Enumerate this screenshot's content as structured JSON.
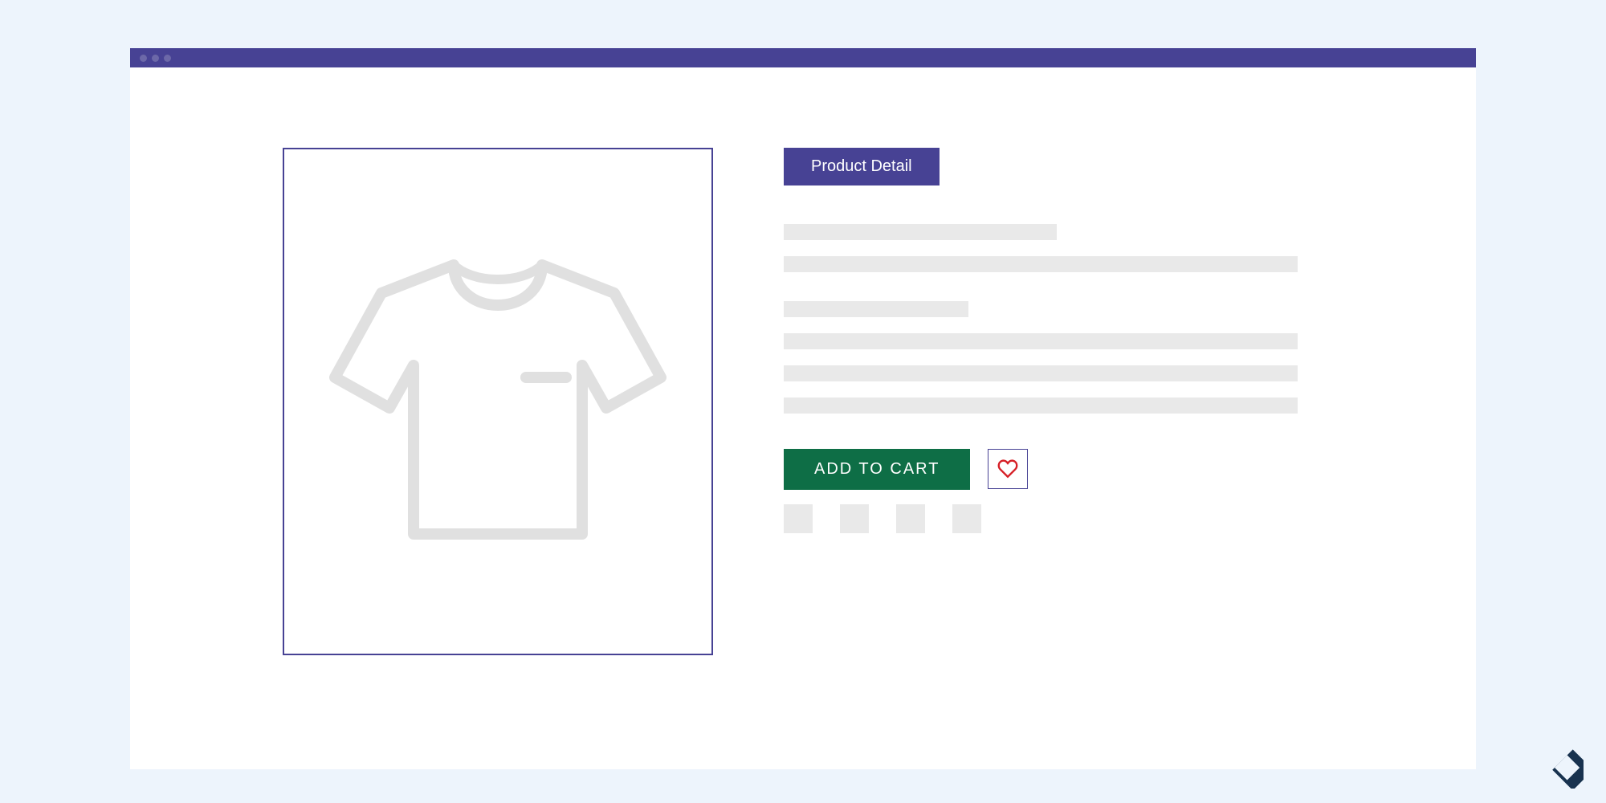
{
  "header": {
    "badge_label": "Product Detail"
  },
  "actions": {
    "add_to_cart_label": "ADD TO CART"
  },
  "colors": {
    "page_bg": "#edf4fc",
    "titlebar": "#474294",
    "accent": "#474294",
    "cta": "#0e6e46",
    "placeholder": "#e9e9e9",
    "heart": "#d61f26"
  },
  "thumbnails": {
    "count": 4
  }
}
